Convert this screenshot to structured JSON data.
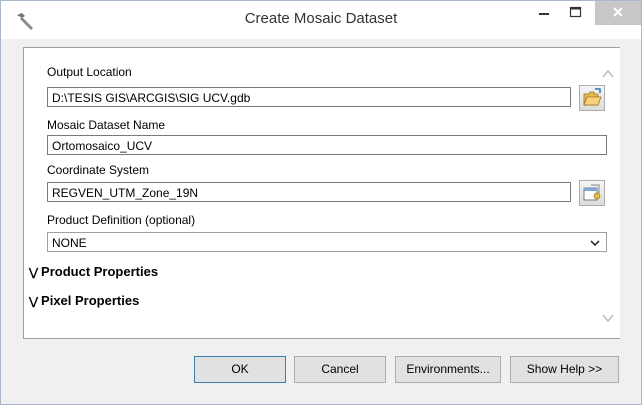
{
  "window": {
    "title": "Create Mosaic Dataset"
  },
  "fields": {
    "output_location": {
      "label": "Output Location",
      "value": "D:\\TESIS GIS\\ARCGIS\\SIG UCV.gdb"
    },
    "mosaic_name": {
      "label": "Mosaic Dataset Name",
      "value": "Ortomosaico_UCV"
    },
    "coordinate_system": {
      "label": "Coordinate System",
      "value": "REGVEN_UTM_Zone_19N"
    },
    "product_definition": {
      "label": "Product Definition (optional)",
      "value": "NONE"
    }
  },
  "sections": {
    "product_properties": "Product Properties",
    "pixel_properties": "Pixel Properties"
  },
  "buttons": {
    "ok": "OK",
    "cancel": "Cancel",
    "environments": "Environments...",
    "show_help": "Show Help >>"
  },
  "icons": {
    "title": "hammer-icon",
    "browse_folder": "open-folder-icon",
    "coordinate_properties": "properties-icon"
  }
}
